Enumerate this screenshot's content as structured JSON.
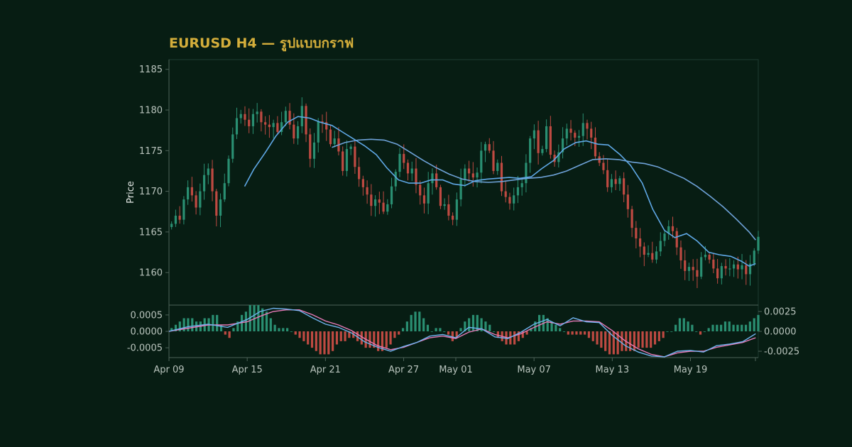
{
  "chart_data": {
    "type": "candlestick",
    "title": "EURUSD H4 — รูปแบบกราฟ",
    "colors": {
      "background": "#071d13",
      "title": "#d4ae3b",
      "up": "#2a8f72",
      "down": "#bf4a42",
      "ma_fast": "#5fa8e6",
      "ma_slow": "#6ea2d8",
      "macd": "#6fb2ee",
      "signal": "#e77ab8",
      "axis": "#4d6258",
      "text": "#b9c4bd"
    },
    "x_ticks": [
      "Apr 09",
      "Apr 15",
      "Apr 21",
      "Apr 27",
      "May 01",
      "May 07",
      "May 13",
      "May 19"
    ],
    "x_tick_days": [
      0,
      6,
      12,
      18,
      22,
      28,
      34,
      40
    ],
    "x_range_days": [
      0,
      45.2
    ],
    "price_panel": {
      "ylabel": "Price",
      "ylim": [
        1156,
        1186.2
      ],
      "yticks": [
        1160,
        1165,
        1170,
        1175,
        1180,
        1185
      ],
      "closes": [
        1166,
        1167,
        1166.5,
        1169,
        1170.5,
        1169.5,
        1168,
        1170,
        1172,
        1172.8,
        1170,
        1167,
        1169,
        1171,
        1174,
        1177,
        1179,
        1179.5,
        1178.8,
        1178,
        1179.5,
        1179.8,
        1178.5,
        1178.2,
        1177.9,
        1178.4,
        1177.3,
        1178.5,
        1179.9,
        1178.2,
        1176.5,
        1178,
        1180.5,
        1177,
        1174,
        1176,
        1178.6,
        1178.5,
        1177.6,
        1175.8,
        1176.5,
        1174.9,
        1172.5,
        1175.2,
        1175.5,
        1173,
        1171.5,
        1170.5,
        1169.6,
        1168.2,
        1169,
        1168.6,
        1167.5,
        1168.4,
        1170.6,
        1172.4,
        1174.6,
        1173.5,
        1172.2,
        1172.8,
        1170.8,
        1169.5,
        1168.5,
        1171,
        1172.2,
        1170.5,
        1168.2,
        1168.4,
        1167,
        1166.5,
        1169,
        1171.5,
        1172.8,
        1172.2,
        1171.7,
        1172.3,
        1175,
        1175.8,
        1175,
        1172.5,
        1173.5,
        1170,
        1169.3,
        1168.5,
        1169.5,
        1170.5,
        1171,
        1173.5,
        1176.5,
        1177.5,
        1174.7,
        1175.2,
        1178,
        1174.5,
        1173.6,
        1174.8,
        1176.5,
        1177.7,
        1177.2,
        1176.6,
        1176.8,
        1178.4,
        1177.7,
        1176.6,
        1174.3,
        1173.5,
        1172.6,
        1170.5,
        1171.5,
        1170.9,
        1171.6,
        1169.6,
        1167.8,
        1165.5,
        1164.2,
        1163.2,
        1162.2,
        1162.4,
        1161.6,
        1162.6,
        1163.9,
        1164.8,
        1165.7,
        1165.1,
        1163.1,
        1161.5,
        1160.2,
        1160.7,
        1160.3,
        1159.5,
        1161.9,
        1162.2,
        1161.6,
        1160.5,
        1159.3,
        1160.8,
        1160.5,
        1160.5,
        1161,
        1160.4,
        1160.9,
        1159.8,
        1161.1,
        1162.7,
        1164.4
      ],
      "ma_fast": [
        [
          5.8,
          1170.6
        ],
        [
          6.5,
          1172.7
        ],
        [
          7.4,
          1174.8
        ],
        [
          8.2,
          1176.8
        ],
        [
          9.1,
          1178.5
        ],
        [
          9.9,
          1179.2
        ],
        [
          10.8,
          1179.0
        ],
        [
          11.6,
          1178.5
        ],
        [
          12.5,
          1178.1
        ],
        [
          13.3,
          1177.3
        ],
        [
          14.2,
          1176.4
        ],
        [
          15.0,
          1175.6
        ],
        [
          15.9,
          1174.5
        ],
        [
          16.7,
          1172.9
        ],
        [
          17.6,
          1171.4
        ],
        [
          18.4,
          1171.0
        ],
        [
          19.3,
          1171.0
        ],
        [
          20.1,
          1171.4
        ],
        [
          21.0,
          1171.4
        ],
        [
          21.8,
          1170.9
        ],
        [
          22.7,
          1170.7
        ],
        [
          23.5,
          1171.3
        ],
        [
          24.4,
          1171.5
        ],
        [
          25.2,
          1171.6
        ],
        [
          26.1,
          1171.7
        ],
        [
          26.9,
          1171.6
        ],
        [
          27.8,
          1171.8
        ],
        [
          28.6,
          1172.8
        ],
        [
          29.5,
          1173.8
        ],
        [
          30.3,
          1175.2
        ],
        [
          31.2,
          1176.0
        ],
        [
          32.0,
          1176.2
        ],
        [
          32.9,
          1175.8
        ],
        [
          33.7,
          1175.7
        ],
        [
          34.6,
          1174.5
        ],
        [
          35.4,
          1173.2
        ],
        [
          36.3,
          1171.0
        ],
        [
          37.1,
          1167.8
        ],
        [
          38.0,
          1165.2
        ],
        [
          38.8,
          1164.3
        ],
        [
          39.7,
          1164.8
        ],
        [
          40.5,
          1163.9
        ],
        [
          41.4,
          1162.5
        ],
        [
          42.2,
          1162.2
        ],
        [
          43.1,
          1162.0
        ],
        [
          43.9,
          1161.4
        ],
        [
          44.5,
          1160.8
        ],
        [
          45.0,
          1161.1
        ]
      ],
      "ma_slow": [
        [
          12.5,
          1175.4
        ],
        [
          13.5,
          1176.0
        ],
        [
          14.5,
          1176.3
        ],
        [
          15.5,
          1176.4
        ],
        [
          16.5,
          1176.3
        ],
        [
          17.5,
          1175.8
        ],
        [
          18.5,
          1174.8
        ],
        [
          19.5,
          1173.8
        ],
        [
          20.5,
          1172.9
        ],
        [
          21.5,
          1172.1
        ],
        [
          22.5,
          1171.5
        ],
        [
          23.5,
          1171.2
        ],
        [
          24.5,
          1171.1
        ],
        [
          25.5,
          1171.2
        ],
        [
          26.5,
          1171.4
        ],
        [
          27.5,
          1171.6
        ],
        [
          28.5,
          1171.7
        ],
        [
          29.5,
          1172.0
        ],
        [
          30.5,
          1172.5
        ],
        [
          31.5,
          1173.2
        ],
        [
          32.5,
          1173.9
        ],
        [
          33.5,
          1174.0
        ],
        [
          34.5,
          1173.9
        ],
        [
          35.5,
          1173.6
        ],
        [
          36.5,
          1173.4
        ],
        [
          37.5,
          1173.0
        ],
        [
          38.5,
          1172.3
        ],
        [
          39.5,
          1171.6
        ],
        [
          40.5,
          1170.6
        ],
        [
          41.5,
          1169.4
        ],
        [
          42.5,
          1168.1
        ],
        [
          43.5,
          1166.6
        ],
        [
          44.5,
          1165.0
        ],
        [
          45.0,
          1164.0
        ]
      ]
    },
    "macd_panel": {
      "left_ylim": [
        -0.0008,
        0.0008
      ],
      "left_ticks": [
        0.0005,
        0.0,
        -0.0005
      ],
      "left_tick_labels": [
        "0.0005",
        "0.0000",
        "-0.0005"
      ],
      "right_ylim": [
        -0.0033,
        0.0033
      ],
      "right_ticks": [
        0.0025,
        0.0,
        -0.0025
      ],
      "right_tick_labels": [
        "0.0025",
        "0.0000",
        "-0.0025"
      ],
      "histogram": [
        0.0001,
        0.0002,
        0.0003,
        0.0004,
        0.0004,
        0.0004,
        0.0003,
        0.0003,
        0.0004,
        0.0004,
        0.0005,
        0.0005,
        0.0002,
        -0.0001,
        -0.0002,
        0.0001,
        0.0003,
        0.0005,
        0.0006,
        0.0008,
        0.0008,
        0.0008,
        0.0007,
        0.0006,
        0.0004,
        0.0002,
        0.0001,
        0.0001,
        0.0001,
        0.0,
        -0.0001,
        -0.0002,
        -0.0003,
        -0.0004,
        -0.0005,
        -0.0006,
        -0.0007,
        -0.0007,
        -0.0007,
        -0.0006,
        -0.0004,
        -0.0003,
        -0.0003,
        -0.0002,
        -0.0002,
        -0.0003,
        -0.0004,
        -0.0005,
        -0.0005,
        -0.0005,
        -0.0006,
        -0.0006,
        -0.0005,
        -0.0004,
        -0.0002,
        -0.0001,
        0.0001,
        0.0003,
        0.0005,
        0.0006,
        0.0006,
        0.0004,
        0.0002,
        0.0,
        0.0001,
        0.0001,
        -0.0,
        -0.0001,
        -0.0003,
        -0.0002,
        0.0001,
        0.0003,
        0.0004,
        0.0005,
        0.0005,
        0.0004,
        0.0003,
        0.0002,
        -0.0,
        -0.0002,
        -0.0003,
        -0.0004,
        -0.0004,
        -0.0004,
        -0.0003,
        -0.0002,
        -0.0001,
        0.0001,
        0.0003,
        0.0005,
        0.0005,
        0.0004,
        0.0003,
        0.0002,
        0.0001,
        -0.0,
        -0.0001,
        -0.0001,
        -0.0001,
        -0.0001,
        -0.0001,
        -0.0002,
        -0.0003,
        -0.0004,
        -0.0005,
        -0.0006,
        -0.0007,
        -0.0007,
        -0.0007,
        -0.0006,
        -0.0006,
        -0.0006,
        -0.0006,
        -0.0005,
        -0.0005,
        -0.0005,
        -0.0005,
        -0.0004,
        -0.0003,
        -0.0002,
        -0.0,
        0.0,
        0.0002,
        0.0004,
        0.0004,
        0.0003,
        0.0002,
        0.0,
        -0.0001,
        -0.0,
        0.0001,
        0.0002,
        0.0002,
        0.0002,
        0.0003,
        0.0003,
        0.0002,
        0.0002,
        0.0002,
        0.0002,
        0.0003,
        0.0004,
        0.0005
      ],
      "macd_line": [
        [
          0.0,
          0.0
        ],
        [
          1.5,
          0.0006
        ],
        [
          3.0,
          0.0009
        ],
        [
          4.5,
          0.0005
        ],
        [
          6.0,
          0.0015
        ],
        [
          7.0,
          0.0025
        ],
        [
          8.0,
          0.0029
        ],
        [
          9.0,
          0.0028
        ],
        [
          10.0,
          0.0026
        ],
        [
          11.0,
          0.0017
        ],
        [
          12.0,
          0.0009
        ],
        [
          13.0,
          0.0005
        ],
        [
          14.0,
          -0.0002
        ],
        [
          15.0,
          -0.0013
        ],
        [
          16.0,
          -0.002
        ],
        [
          17.0,
          -0.0025
        ],
        [
          18.0,
          -0.0019
        ],
        [
          19.0,
          -0.0014
        ],
        [
          20.0,
          -0.0006
        ],
        [
          21.0,
          -0.0004
        ],
        [
          22.0,
          -0.0008
        ],
        [
          23.0,
          0.0005
        ],
        [
          24.0,
          0.0003
        ],
        [
          25.0,
          -0.0007
        ],
        [
          26.0,
          -0.0009
        ],
        [
          27.0,
          -0.0001
        ],
        [
          28.0,
          0.0009
        ],
        [
          29.0,
          0.0015
        ],
        [
          30.0,
          0.0007
        ],
        [
          31.0,
          0.0017
        ],
        [
          32.0,
          0.0012
        ],
        [
          33.0,
          0.0011
        ],
        [
          34.0,
          -0.0005
        ],
        [
          35.0,
          -0.0018
        ],
        [
          36.0,
          -0.0026
        ],
        [
          37.0,
          -0.0031
        ],
        [
          38.0,
          -0.0032
        ],
        [
          39.0,
          -0.0025
        ],
        [
          40.0,
          -0.0024
        ],
        [
          41.0,
          -0.0026
        ],
        [
          42.0,
          -0.0018
        ],
        [
          43.0,
          -0.0016
        ],
        [
          44.0,
          -0.0013
        ],
        [
          45.0,
          -0.0003
        ]
      ],
      "signal_line": [
        [
          0.0,
          0.0
        ],
        [
          1.5,
          0.0004
        ],
        [
          3.0,
          0.0008
        ],
        [
          4.5,
          0.0008
        ],
        [
          6.0,
          0.0012
        ],
        [
          7.0,
          0.0019
        ],
        [
          8.0,
          0.0025
        ],
        [
          9.0,
          0.0027
        ],
        [
          10.0,
          0.0027
        ],
        [
          11.0,
          0.0021
        ],
        [
          12.0,
          0.0013
        ],
        [
          13.0,
          0.0008
        ],
        [
          14.0,
          0.0001
        ],
        [
          15.0,
          -0.0009
        ],
        [
          16.0,
          -0.0018
        ],
        [
          17.0,
          -0.0023
        ],
        [
          18.0,
          -0.002
        ],
        [
          19.0,
          -0.0014
        ],
        [
          20.0,
          -0.0008
        ],
        [
          21.0,
          -0.0006
        ],
        [
          22.0,
          -0.0009
        ],
        [
          23.0,
          -0.0001
        ],
        [
          24.0,
          0.0003
        ],
        [
          25.0,
          -0.0004
        ],
        [
          26.0,
          -0.0008
        ],
        [
          27.0,
          -0.0003
        ],
        [
          28.0,
          0.0005
        ],
        [
          29.0,
          0.0012
        ],
        [
          30.0,
          0.0009
        ],
        [
          31.0,
          0.0013
        ],
        [
          32.0,
          0.0013
        ],
        [
          33.0,
          0.0012
        ],
        [
          34.0,
          0.0001
        ],
        [
          35.0,
          -0.0012
        ],
        [
          36.0,
          -0.0022
        ],
        [
          37.0,
          -0.0029
        ],
        [
          38.0,
          -0.0032
        ],
        [
          39.0,
          -0.0027
        ],
        [
          40.0,
          -0.0025
        ],
        [
          41.0,
          -0.0025
        ],
        [
          42.0,
          -0.002
        ],
        [
          43.0,
          -0.0017
        ],
        [
          44.0,
          -0.0014
        ],
        [
          45.0,
          -0.0008
        ]
      ]
    }
  }
}
